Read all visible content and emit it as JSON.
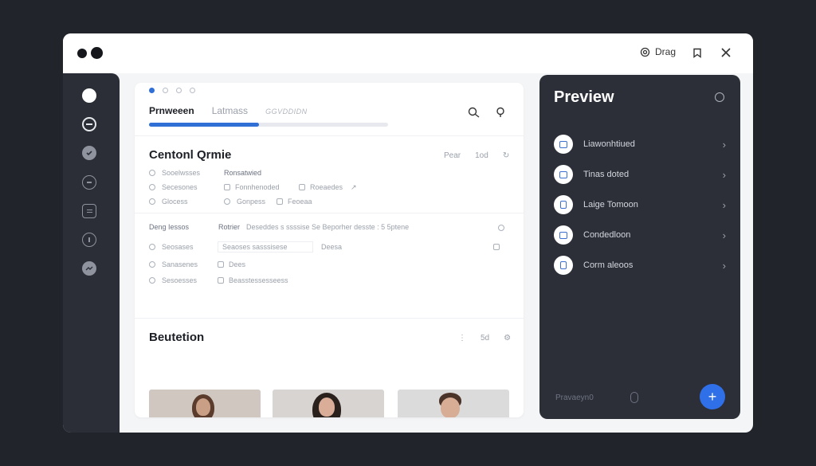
{
  "window": {
    "drag_label": "Drag"
  },
  "main": {
    "tabs": [
      {
        "label": "Prnweeen"
      },
      {
        "label": "Latmass"
      },
      {
        "label": "GGVDDIDN"
      }
    ],
    "progress": 0.46,
    "section1": {
      "title": "Centonl Qrmie",
      "tools": [
        "Pear",
        "1od"
      ],
      "rows": [
        {
          "label": "Sooelwsses",
          "value": "Ronsatwied"
        },
        {
          "label": "Secesones",
          "value": "Fonnhenoded",
          "extra": "Roeaedes"
        },
        {
          "label": "Glocess",
          "value": "Gonpess",
          "extra": "Feoeaa"
        }
      ]
    },
    "section2": {
      "title": "Deng Iessos",
      "subtitle": "Rotrier",
      "description": "Deseddes s ssssise Se Beporher desste : 5 5ptene",
      "rows": [
        {
          "label": "Seosases",
          "value": "Seaoses sasssisese",
          "extra": "Deesa"
        },
        {
          "label": "Sanasenes",
          "value": "Dees"
        },
        {
          "label": "Sesoesses",
          "value": "Beasstessesseess"
        }
      ]
    },
    "section3": {
      "title": "Beutetion",
      "tools": [
        "5d"
      ]
    }
  },
  "preview": {
    "title": "Preview",
    "items": [
      {
        "label": "Liawonhtiued"
      },
      {
        "label": "Tinas doted"
      },
      {
        "label": "Laige Tomoon"
      },
      {
        "label": "Condedloon"
      },
      {
        "label": "Corm aleoos"
      }
    ],
    "footer": "Pravaeyn0"
  },
  "colors": {
    "accent": "#2f6fe8",
    "sidebar": "#2b2e37",
    "preview_panel": "#2c2f38",
    "background": "#22242c"
  }
}
